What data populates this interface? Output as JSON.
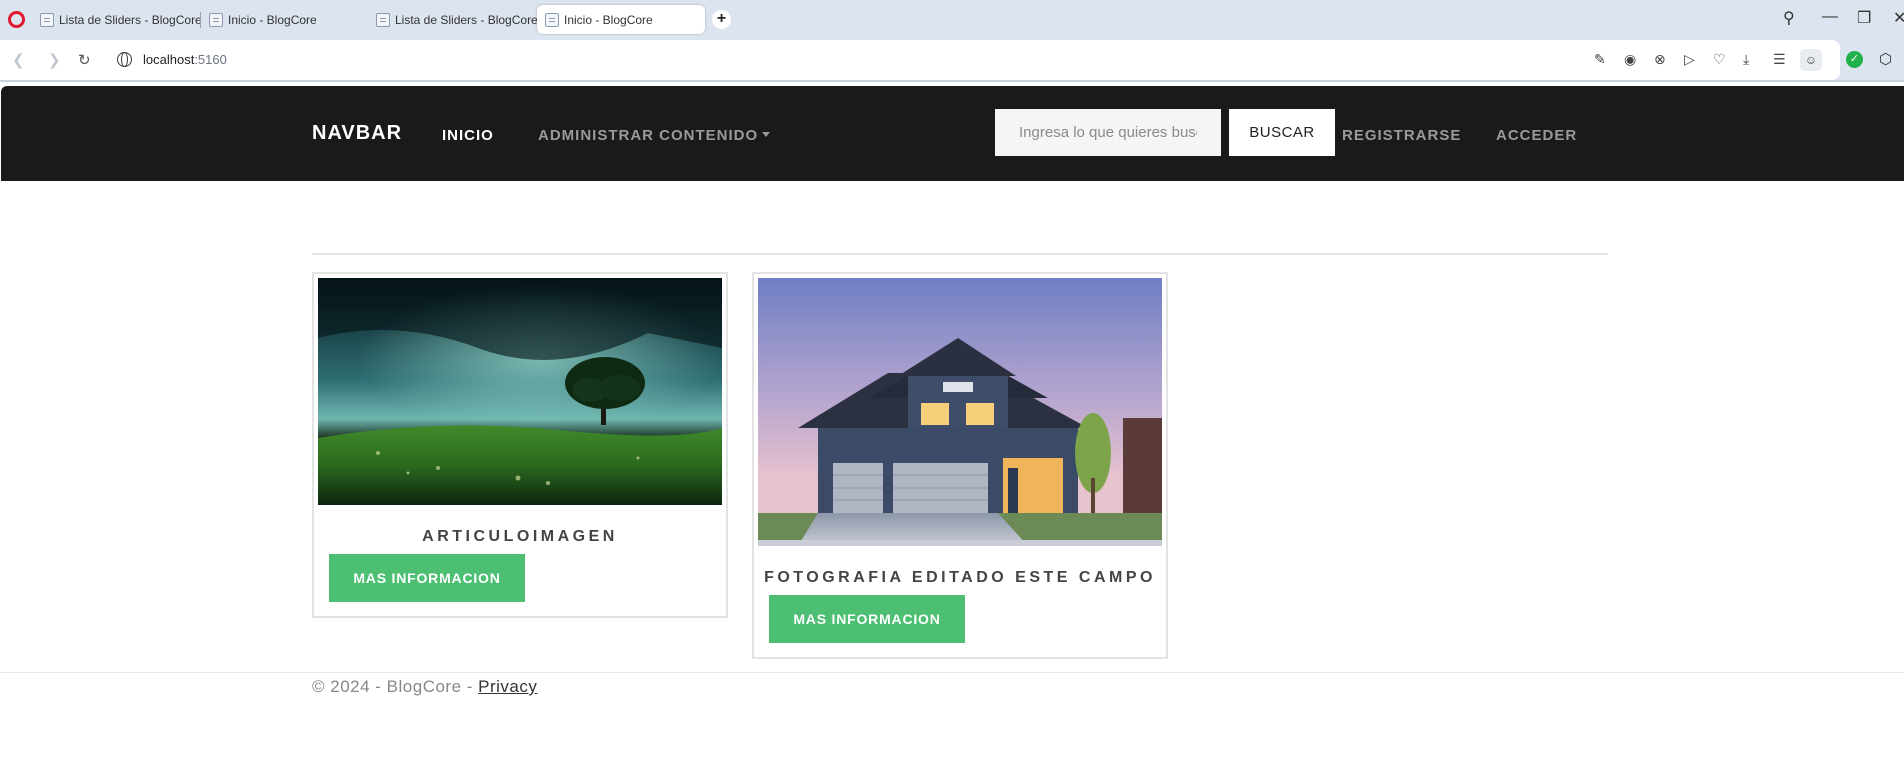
{
  "browser": {
    "tabs": [
      {
        "title": "Lista de Sliders - BlogCore",
        "active": false
      },
      {
        "title": "Inicio - BlogCore",
        "active": false
      },
      {
        "title": "Lista de Sliders - BlogCore",
        "active": false
      },
      {
        "title": "Inicio - BlogCore",
        "active": true
      }
    ],
    "url_host": "localhost",
    "url_port": ":5160"
  },
  "navbar": {
    "brand": "NAVBAR",
    "links": {
      "inicio": "INICIO",
      "admin": "ADMINISTRAR CONTENIDO",
      "register": "REGISTRARSE",
      "login": "ACCEDER"
    },
    "search_placeholder": "Ingresa lo que quieres buscar",
    "search_button": "BUSCAR"
  },
  "articles": [
    {
      "title": "ARTICULOIMAGEN",
      "button": "MAS INFORMACION",
      "image": "landscape-tree-image"
    },
    {
      "title": "FOTOGRAFIA EDITADO ESTE CAMPO",
      "button": "MAS INFORMACION",
      "image": "house-photo-image"
    }
  ],
  "footer": {
    "text": "© 2024 - BlogCore - ",
    "link": "Privacy"
  },
  "colors": {
    "navbar_bg": "#1a1a1a",
    "button_green": "#4cbf72",
    "chrome_bg": "#dbe4ef"
  }
}
